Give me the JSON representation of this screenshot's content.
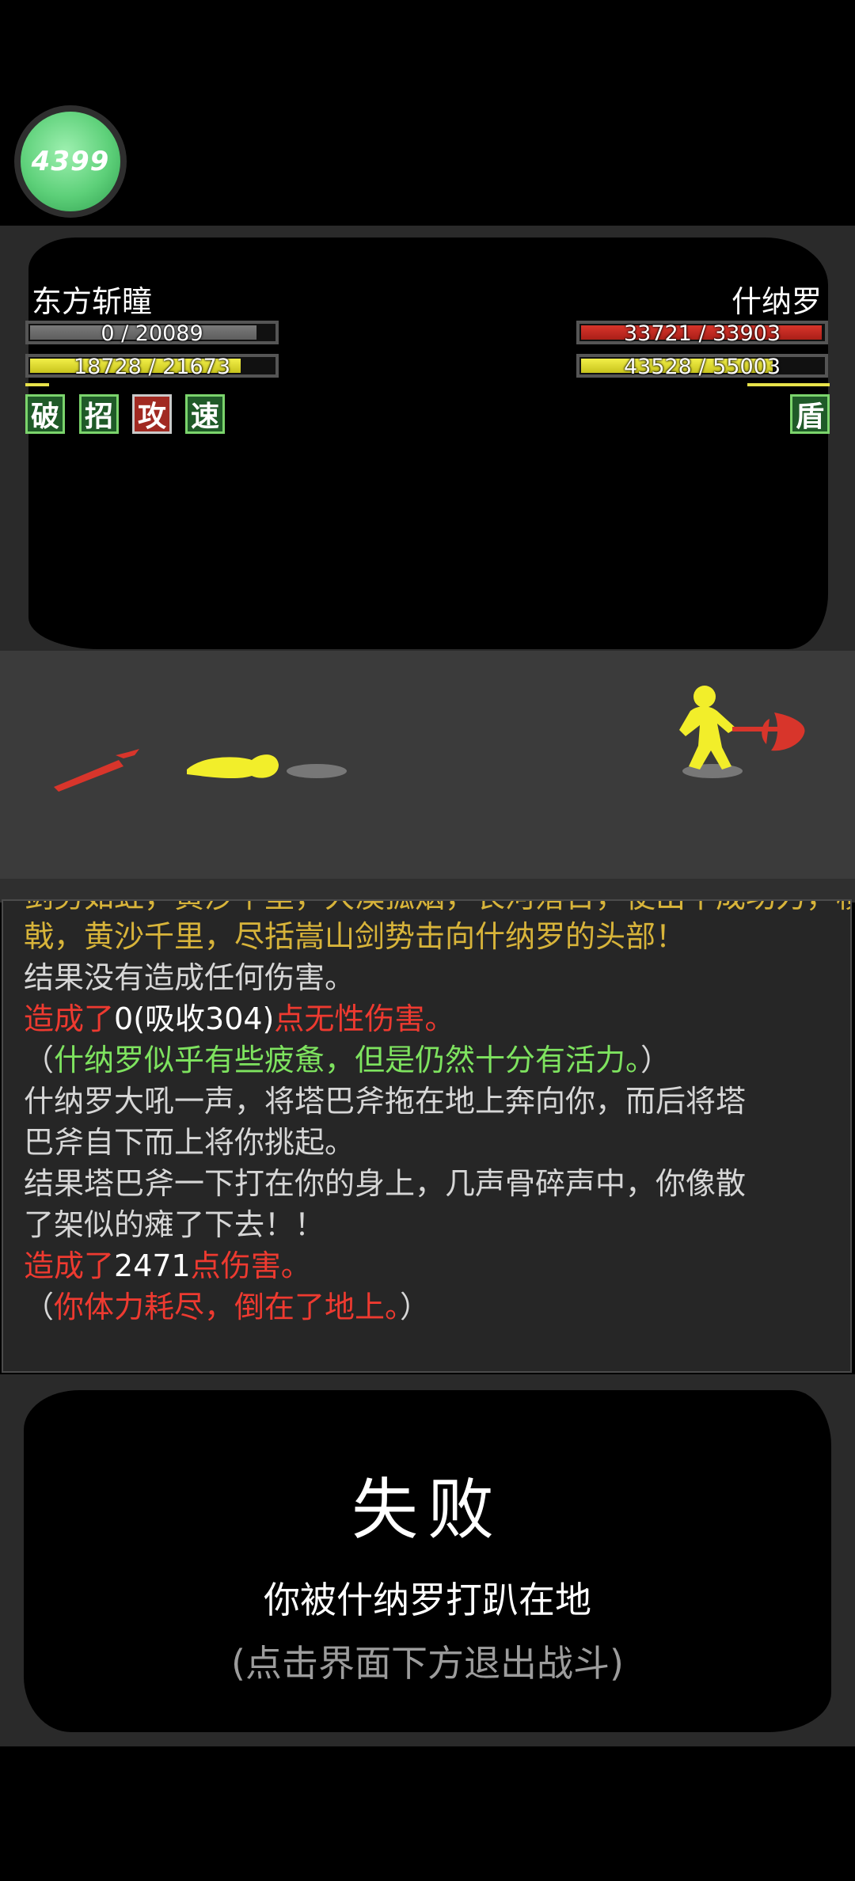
{
  "badge": {
    "label": "4399"
  },
  "player": {
    "name": "东方斩瞳",
    "hp_text": "0 / 20089",
    "hp_fraction": 0,
    "sp_text": "18728 / 21673",
    "sp_fraction": 0.864,
    "skills": [
      "破",
      "招",
      "攻",
      "速"
    ]
  },
  "enemy": {
    "name": "什纳罗",
    "hp_text": "33721 / 33903",
    "hp_fraction": 0.995,
    "sp_text": "43528 / 55003",
    "sp_fraction": 0.791,
    "skills": [
      "盾"
    ]
  },
  "log": {
    "line1": "剑势如虹，黄沙千里，大漠孤烟，长河落日，使出十成功力，横扫千军，气吞万里，长枪大",
    "line2": "戟，黄沙千里，尽括嵩山剑势击向什纳罗的头部！",
    "line3": "结果没有造成任何伤害。",
    "line4_a": "造成了",
    "line4_b": "0(吸收304)",
    "line4_c": "点无性伤害。",
    "line5_a": "（",
    "line5_b": "什纳罗似乎有些疲惫，但是仍然十分有活力。",
    "line5_c": "）",
    "line6": "什纳罗大吼一声，将塔巴斧拖在地上奔向你，而后将塔",
    "line7": "巴斧自下而上将你挑起。",
    "line8": "结果塔巴斧一下打在你的身上，几声骨碎声中，你像散",
    "line9": "了架似的瘫了下去！！",
    "line10_a": "造成了",
    "line10_b": "2471",
    "line10_c": "点伤害。",
    "line11_a": "（",
    "line11_b": "你体力耗尽，倒在了地上。",
    "line11_c": "）"
  },
  "result": {
    "title": "失败",
    "message": "你被什纳罗打趴在地",
    "hint": "(点击界面下方退出战斗)"
  },
  "colors": {
    "hp": "#d8352b",
    "sp": "#e8e24a",
    "log_red": "#ee3a30",
    "log_green": "#7ee35f",
    "log_gold": "#d8b43a"
  }
}
